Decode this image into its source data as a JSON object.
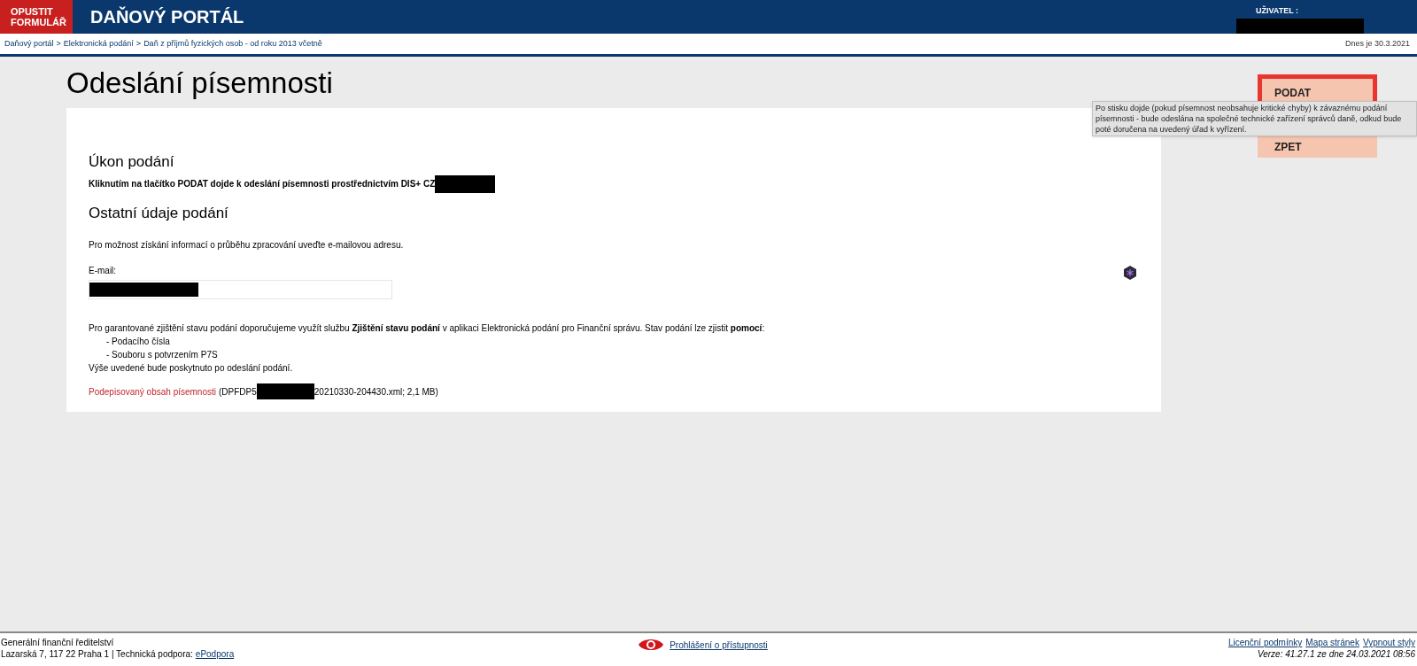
{
  "header": {
    "exit_button": "OPUSTIT FORMULÁŘ",
    "title": "DAŇOVÝ PORTÁL",
    "user_label": "UŽIVATEL :"
  },
  "breadcrumb": [
    "Daňový portál",
    "Elektronická podání",
    "Daň z příjmů fyzických osob - od roku 2013 včetně"
  ],
  "breadcrumb_separator": ">",
  "date": "Dnes je 30.3.2021",
  "page_title": "Odeslání písemnosti",
  "section1": {
    "heading": "Úkon podání",
    "text": "Kliknutím na tlačítko PODAT dojde k odeslání písemnosti prostřednictvím DIS+ CZ"
  },
  "section2": {
    "heading": "Ostatní údaje podání",
    "intro": "Pro možnost získání informací o průběhu zpracování uveďte e-mailovou adresu.",
    "email_label": "E-mail:",
    "note": "Pro garantované zjištění stavu podání doporučujeme využít službu **Zjištění stavu podání** v aplikaci Elektronická podání pro Finanční správu. Stav podání lze zjistit **pomocí**:",
    "note_items": [
      "- Podacího čísla",
      "- Souboru s potvrzením P7S"
    ],
    "note_end": "Výše uvedené bude poskytnuto po odeslání podání.",
    "file_link": "Podepisovaný obsah písemnosti",
    "file_prefix": "(DPFDP5",
    "file_suffix": "20210330-204430.xml; 2,1 MB)"
  },
  "actions": [
    {
      "label": "PODAT",
      "focused": true
    },
    {
      "label": "ZPET",
      "focused": false
    }
  ],
  "tooltip": "Po stisku dojde (pokud písemnost neobsahuje kritické chyby) k závaznému podání písemnosti - bude odeslána na společné technické zařízení správců daně, odkud bude poté doručena na uvedený úřad k vyřízení.",
  "footer": {
    "org": "Generální finanční ředitelství",
    "address": "Lazarská 7, 117 22 Praha 1 | Technická podpora:",
    "support_link": "ePodpora",
    "accessibility_link": "Prohlášení o přístupnosti",
    "links": [
      "Licenční podmínky",
      "Mapa stránek",
      "Vypnout styly"
    ],
    "version": "Verze: 41.27.1 ze dne 24.03.2021 08:56"
  }
}
